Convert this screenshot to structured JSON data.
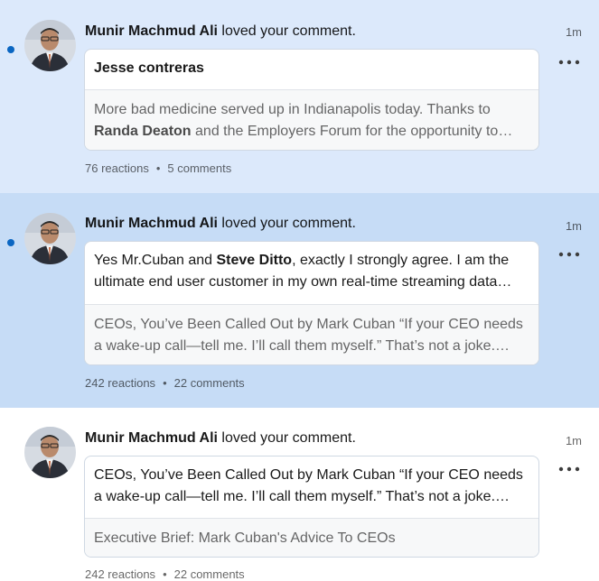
{
  "colors": {
    "unread_bg_1": "#dce9fb",
    "unread_bg_2": "#c6dcf6",
    "read_bg": "#ffffff",
    "unread_dot": "#0a66c2"
  },
  "notifications": [
    {
      "actor": "Munir Machmud Ali",
      "action": " loved your comment.",
      "time": "1m",
      "unread": true,
      "card_top": "Jesse contreras",
      "card_bottom": {
        "pre": "More bad medicine served up in Indianapolis today. Thanks to ",
        "mention": "Randa Deaton",
        "post": " and the Employers Forum for the opportunity to speak at the Employers Forum of Indiana on how employers can save money with better health"
      },
      "reactions": "76 reactions",
      "comments": "5 comments"
    },
    {
      "actor": "Munir Machmud Ali",
      "action": " loved your comment.",
      "time": "1m",
      "unread": true,
      "card_top": {
        "pre": "Yes Mr.Cuban and ",
        "mention": "Steve Ditto",
        "post": ", exactly I strongly agree. I am the ultimate end user customer in my own real-time streaming data platform"
      },
      "card_bottom": "CEOs, You’ve Been Called Out by Mark Cuban “If your CEO needs a wake-up call—tell me. I’ll call them myself.” That’s not a joke. That’s a warning.",
      "reactions": "242 reactions",
      "comments": "22 comments"
    },
    {
      "actor": "Munir Machmud Ali",
      "action": " loved your comment.",
      "time": "1m",
      "unread": false,
      "card_top": "CEOs, You’ve Been Called Out by Mark Cuban “If your CEO needs a wake-up call—tell me. I’ll call them myself.” That’s not a joke. That’s a warning.",
      "card_bottom": "Executive Brief: Mark Cuban's Advice To CEOs",
      "reactions": "242 reactions",
      "comments": "22 comments"
    }
  ],
  "separator": "•",
  "icons": {
    "more": "more-options-icon",
    "avatar": "profile-photo"
  }
}
